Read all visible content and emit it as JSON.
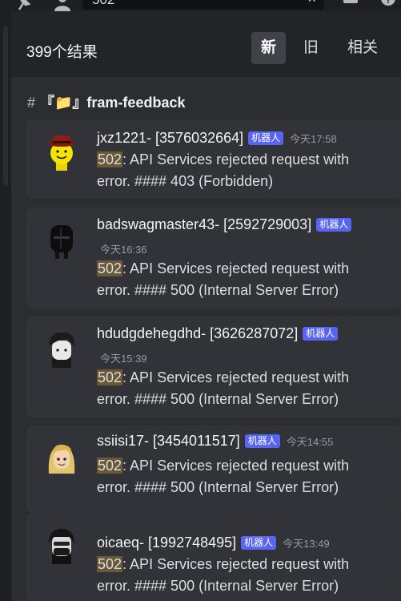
{
  "top_bar": {
    "search_value": "502",
    "clear_symbol": "×"
  },
  "results": {
    "count_label": "399个结果"
  },
  "sort_tabs": [
    {
      "label": "新",
      "active": true
    },
    {
      "label": "旧",
      "active": false
    },
    {
      "label": "相关",
      "active": false
    }
  ],
  "channel": {
    "hash_symbol": "#",
    "name": "『📁』fram-feedback"
  },
  "messages": [
    {
      "author": "jxz1221- [3576032664]",
      "badge": "机器人",
      "time": "今天17:58",
      "highlight": "502",
      "line1_rest": ": API Services rejected request with",
      "line2": "error. #### 403 (Forbidden)"
    },
    {
      "author": "badswagmaster43- [2592729003]",
      "badge": "机器人",
      "time": "今天16:36",
      "highlight": "502",
      "line1_rest": ": API Services rejected request with",
      "line2": "error. #### 500 (Internal Server Error)"
    },
    {
      "author": "hdudgdehegdhd- [3626287072]",
      "badge": "机器人",
      "time": "今天15:39",
      "highlight": "502",
      "line1_rest": ": API Services rejected request with",
      "line2": "error. #### 500 (Internal Server Error)"
    },
    {
      "author": "ssiisi17- [3454011517]",
      "badge": "机器人",
      "time": "今天14:55",
      "highlight": "502",
      "line1_rest": ": API Services rejected request with",
      "line2": "error. #### 500 (Internal Server Error)"
    },
    {
      "author": "oicaeq- [1992748495]",
      "badge": "机器人",
      "time": "今天13:49",
      "highlight": "502",
      "line1_rest": ": API Services rejected request with",
      "line2": "error. #### 500 (Internal Server Error)"
    }
  ],
  "icons": {
    "top_bar": [
      "pin-icon",
      "members-icon",
      "inbox-icon",
      "help-icon"
    ],
    "avatars": [
      "roblox-avatar-yellow-hat",
      "roblox-avatar-black-hood",
      "roblox-avatar-black-hair",
      "roblox-avatar-blonde",
      "roblox-avatar-masked"
    ]
  }
}
